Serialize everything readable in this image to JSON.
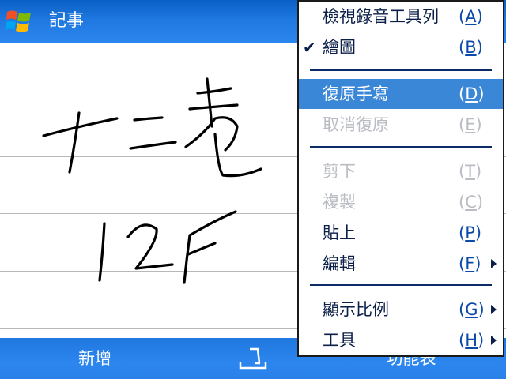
{
  "titlebar": {
    "title": "記事",
    "logo_icon": "windows-flag-icon"
  },
  "note": {
    "line_count": 5,
    "ink_description_icon": "handwriting-ink"
  },
  "softkeys": {
    "left_label": "新增",
    "right_label": "功能表",
    "input_icon": "keyboard-input-icon"
  },
  "menu": {
    "items": [
      {
        "label": "檢視錄音工具列",
        "key_prefix": "(",
        "key": "A",
        "key_suffix": ")",
        "state": "enabled",
        "checked": false,
        "submenu": false
      },
      {
        "label": "繪圖",
        "key_prefix": "(",
        "key": "B",
        "key_suffix": ")",
        "state": "enabled",
        "checked": true,
        "submenu": false
      },
      {
        "label": "復原手寫",
        "key_prefix": "(",
        "key": "D",
        "key_suffix": ")",
        "state": "selected",
        "checked": false,
        "submenu": false
      },
      {
        "label": "取消復原",
        "key_prefix": "(",
        "key": "E",
        "key_suffix": ")",
        "state": "disabled",
        "checked": false,
        "submenu": false
      },
      {
        "label": "剪下",
        "key_prefix": "(",
        "key": "T",
        "key_suffix": ")",
        "state": "disabled",
        "checked": false,
        "submenu": false
      },
      {
        "label": "複製",
        "key_prefix": "(",
        "key": "C",
        "key_suffix": ")",
        "state": "disabled",
        "checked": false,
        "submenu": false
      },
      {
        "label": "貼上",
        "key_prefix": "(",
        "key": "P",
        "key_suffix": ")",
        "state": "enabled",
        "checked": false,
        "submenu": false
      },
      {
        "label": "編輯",
        "key_prefix": "(",
        "key": "F",
        "key_suffix": ")",
        "state": "enabled",
        "checked": false,
        "submenu": true
      },
      {
        "label": "顯示比例",
        "key_prefix": "(",
        "key": "G",
        "key_suffix": ")",
        "state": "enabled",
        "checked": false,
        "submenu": true
      },
      {
        "label": "工具",
        "key_prefix": "(",
        "key": "H",
        "key_suffix": ")",
        "state": "enabled",
        "checked": false,
        "submenu": true
      }
    ],
    "check_glyph": "✔",
    "colors": {
      "selected_bg": "#3a87d8",
      "text": "#0b1f48",
      "disabled": "#b9bcc2"
    }
  }
}
